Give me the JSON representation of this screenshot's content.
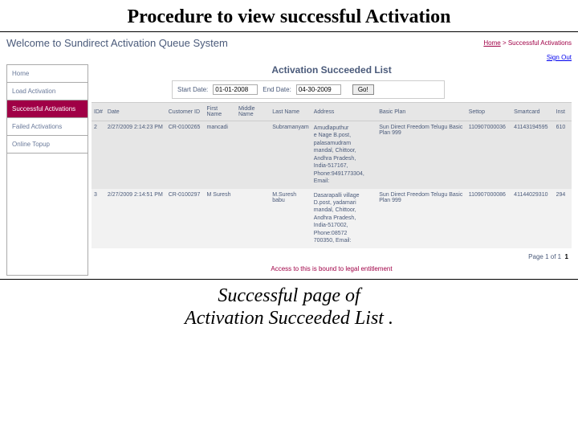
{
  "slide": {
    "title": "Procedure to view successful Activation",
    "caption_line1": "Successful page of",
    "caption_line2": "Activation Succeeded List ."
  },
  "header": {
    "welcome": "Welcome to Sundirect Activation Queue System",
    "breadcrumb_home": "Home",
    "breadcrumb_sep": " > ",
    "breadcrumb_current": "Successful Activations",
    "sign_out": "Sign Out"
  },
  "sidebar": {
    "items": [
      {
        "label": "Home"
      },
      {
        "label": "Load Activation"
      },
      {
        "label": "Successful Activations",
        "active": true
      },
      {
        "label": "Failed Activations"
      },
      {
        "label": "Online Topup"
      }
    ]
  },
  "page": {
    "heading": "Activation Succeeded List",
    "filter": {
      "start_label": "Start Date:",
      "start_value": "01-01-2008",
      "end_label": "End Date:",
      "end_value": "04-30-2009",
      "go": "Go!"
    },
    "columns": {
      "idx": "ID#",
      "date": "Date",
      "cust": "Customer ID",
      "fn": "First Name",
      "mn": "Middle Name",
      "ln": "Last Name",
      "addr": "Address",
      "plan": "Basic Plan",
      "settop": "Settop",
      "smartcard": "Smartcard",
      "inst": "Inst"
    },
    "rows": [
      {
        "idx": "2",
        "date": "2/27/2009 2:14:23 PM",
        "cust": "CR-0100265",
        "fn": "mancadi",
        "mn": "",
        "ln": "Subramanyam",
        "addr": "Amudlaputhur\ne Nage B.post,\npalasamudram\nmandal, Chittoor,\nAndhra Pradesh,\nIndia-517167,\nPhone:9491773304,\nEmail:",
        "plan": "Sun Direct Freedom Telugu Basic Plan 999",
        "settop": "110907000036",
        "smartcard": "41143194595",
        "inst": "610"
      },
      {
        "idx": "3",
        "date": "2/27/2009 2:14:51 PM",
        "cust": "CR-0100297",
        "fn": "M Suresh",
        "mn": "",
        "ln": "M.Suresh babu",
        "addr": "Dasarapalli village\nD.post, yadamari\nmandal, Chittoor,\nAndhra Pradesh,\nIndia-517002,\nPhone:08572\n700350, Email:",
        "plan": "Sun Direct Freedom Telugu Basic Plan 999",
        "settop": "110907000086",
        "smartcard": "41144029310",
        "inst": "294"
      }
    ],
    "pager_label": "Page 1 of 1",
    "pager_current": "1",
    "footer": "Access to this is bound to legal entitlement"
  }
}
